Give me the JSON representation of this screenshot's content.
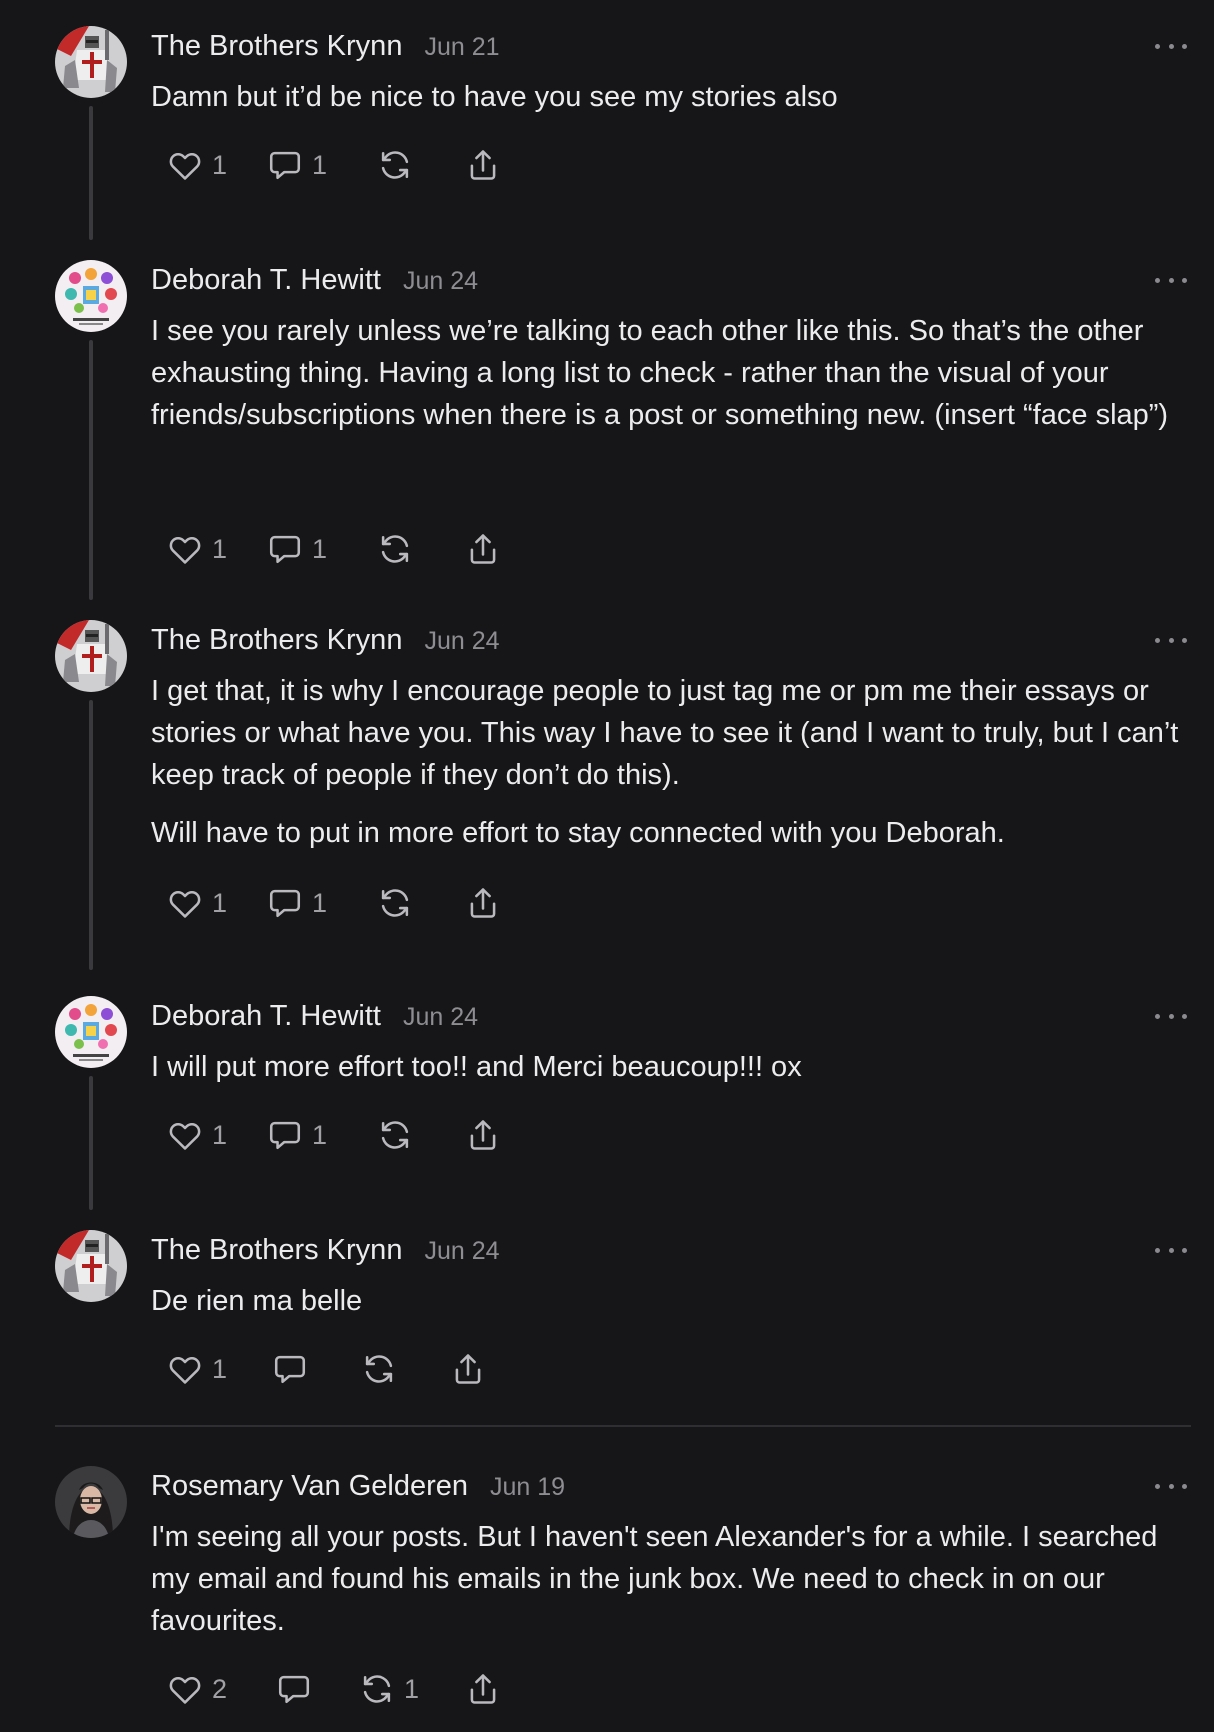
{
  "colors": {
    "background": "#161618",
    "text": "#ececee",
    "muted": "#8d8d92",
    "thread_line": "#3a3a3e",
    "divider": "#2f2f33"
  },
  "comments": [
    {
      "author": "The Brothers Krynn",
      "date": "Jun 21",
      "avatar": "knight-avatar",
      "paragraphs": [
        "Damn but it’d be nice to have you see my stories also"
      ],
      "actions": {
        "likes": "1",
        "replies": "1",
        "restacks": "",
        "share": ""
      }
    },
    {
      "author": "Deborah T. Hewitt",
      "date": "Jun 24",
      "avatar": "book-cover-avatar",
      "paragraphs": [
        "I see you rarely unless we’re talking to each other like this. So that’s the other exhausting thing. Having a long list to check - rather than the visual of your friends/subscriptions when there is a post or something new. (insert “face slap”)"
      ],
      "actions": {
        "likes": "1",
        "replies": "1",
        "restacks": "",
        "share": ""
      }
    },
    {
      "author": "The Brothers Krynn",
      "date": "Jun 24",
      "avatar": "knight-avatar",
      "paragraphs": [
        "I get that, it is why I encourage people to just tag me or pm me their essays or stories or what have you. This way I have to see it (and I want to truly, but I can’t keep track of people if they don’t do this).",
        "Will have to put in more effort to stay connected with you Deborah."
      ],
      "actions": {
        "likes": "1",
        "replies": "1",
        "restacks": "",
        "share": ""
      }
    },
    {
      "author": "Deborah T. Hewitt",
      "date": "Jun 24",
      "avatar": "book-cover-avatar",
      "paragraphs": [
        "I will put more effort too!! and Merci beaucoup!!! ox"
      ],
      "actions": {
        "likes": "1",
        "replies": "1",
        "restacks": "",
        "share": ""
      }
    },
    {
      "author": "The Brothers Krynn",
      "date": "Jun 24",
      "avatar": "knight-avatar",
      "paragraphs": [
        "De rien ma belle"
      ],
      "actions": {
        "likes": "1",
        "replies": "",
        "restacks": "",
        "share": ""
      }
    },
    {
      "author": "Rosemary Van Gelderen",
      "date": "Jun 19",
      "avatar": "portrait-avatar",
      "paragraphs": [
        "I'm seeing all your posts. But I haven't seen Alexander's for a while. I searched my email and found his emails in the junk box. We need to check in on our favourites."
      ],
      "actions": {
        "likes": "2",
        "replies": "",
        "restacks": "1",
        "share": ""
      }
    }
  ]
}
